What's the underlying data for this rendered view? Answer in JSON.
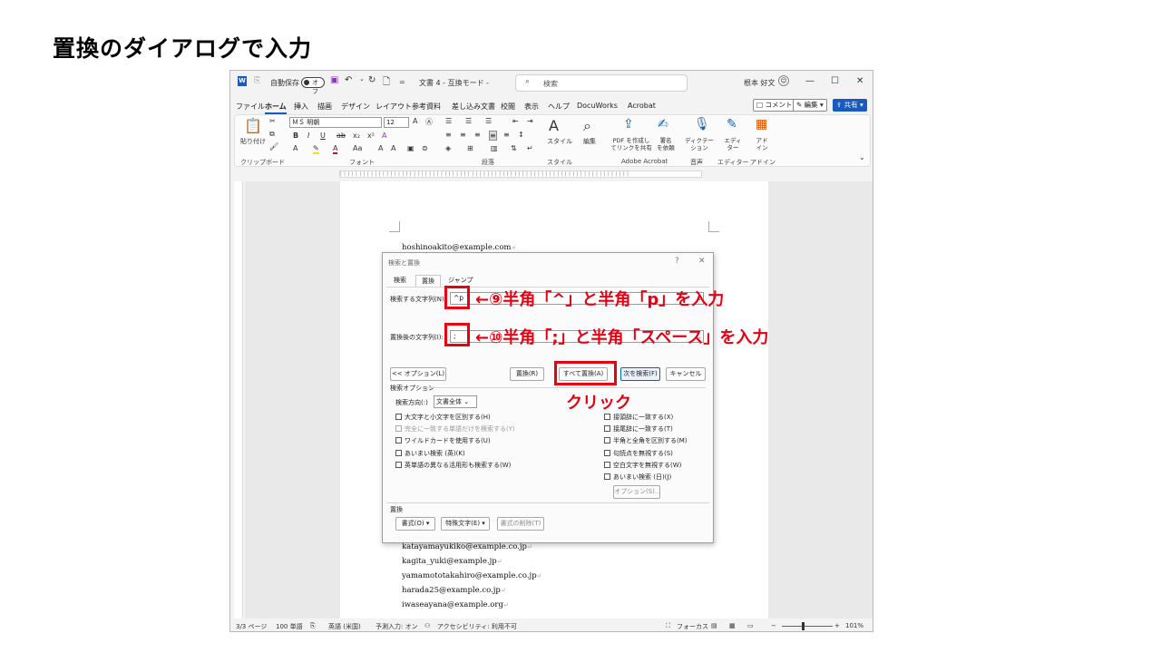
{
  "slide": {
    "title": "置換のダイアログで入力"
  },
  "word": {
    "titlebar": {
      "autosave": "自動保存",
      "toggle": "オフ",
      "qa_more": "=",
      "doc_title": "文書 4 - 互換モード -",
      "search_placeholder": "検索",
      "user": "根本 好文"
    },
    "menu": [
      "ファイル",
      "ホーム",
      "挿入",
      "描画",
      "デザイン",
      "レイアウト",
      "参考資料",
      "差し込み文書",
      "校閲",
      "表示",
      "ヘルプ",
      "DocuWorks",
      "Acrobat"
    ],
    "menu_active": "ホーム",
    "right_buttons": {
      "comment": "コメント",
      "edit": "編集",
      "share": "共有"
    },
    "ribbon": {
      "paste": "貼り付け",
      "font_name": "ＭＳ 明朝",
      "font_size": "12",
      "style": "スタイル",
      "edit": "編集",
      "pdf_share": "PDF を作成し\nてリンクを共有",
      "sign": "署名\nを依頼",
      "dictate": "ディクテー\nション",
      "editor": "エディ\nター",
      "designer": "アド\nイン",
      "groups": [
        "クリップボード",
        "フォント",
        "段落",
        "スタイル",
        "Adobe Acrobat",
        "音声",
        "エディター",
        "アドイン"
      ]
    },
    "document_lines_top": [
      "hoshinoakito@example.com"
    ],
    "document_lines_bottom": [
      "katayamayukiko@example.co.jp",
      "kagita_yuki@example.jp",
      "yamamototakahiro@example.co.jp",
      "harada25@example.co.jp",
      "iwaseayana@example.org"
    ],
    "status": {
      "page": "3/3 ページ",
      "words": "100 単語",
      "lang": "英語 (米国)",
      "predict": "予測入力: オン",
      "access": "アクセシビリティ: 利用不可",
      "focus": "フォーカス",
      "zoom": "101%"
    }
  },
  "dialog": {
    "title": "検索と置換",
    "help": "?",
    "close": "✕",
    "tabs": [
      "検索",
      "置換",
      "ジャンプ"
    ],
    "active_tab": "置換",
    "find_label": "検索する文字列(N):",
    "find_value": "^p",
    "replace_label": "置換後の文字列(I):",
    "replace_value": ";",
    "buttons": {
      "options": "<< オプション(L)",
      "replace": "置換(R)",
      "replace_all": "すべて置換(A)",
      "find_next": "次を検索(F)",
      "cancel": "キャンセル"
    },
    "search_options_title": "検索オプション",
    "direction_label": "検索方向(:)",
    "direction_value": "文書全体",
    "left_checks": [
      "大文字と小文字を区別する(H)",
      "完全に一致する単語だけを検索する(Y)",
      "ワイルドカードを使用する(U)",
      "あいまい検索 (英)(K)",
      "英単語の異なる活用形も検索する(W)"
    ],
    "right_checks": [
      "接頭辞に一致する(X)",
      "接尾辞に一致する(T)",
      "半角と全角を区別する(M)",
      "句読点を無視する(S)",
      "空白文字を無視する(W)",
      "あいまい検索 (日)(J)"
    ],
    "options_button": "オプション(S)...",
    "replace_section": "置換",
    "format_button": "書式(O) ▾",
    "special_button": "特殊文字(E) ▾",
    "no_format_button": "書式の削除(T)"
  },
  "annotations": {
    "a9": "←⑨半角「^」と半角「p」を入力",
    "a10": "←⑩半角「;」と半角「スペース」を入力",
    "click": "クリック",
    "color": "#e60012"
  }
}
